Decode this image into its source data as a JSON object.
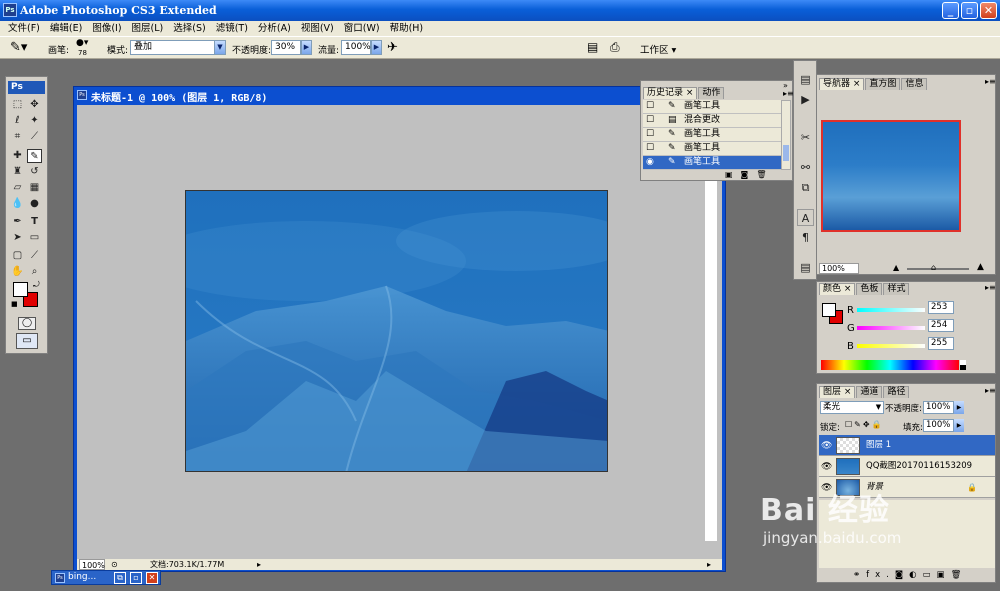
{
  "window": {
    "title": "Adobe Photoshop CS3 Extended"
  },
  "menu": [
    "文件(F)",
    "编辑(E)",
    "图像(I)",
    "图层(L)",
    "选择(S)",
    "滤镜(T)",
    "分析(A)",
    "视图(V)",
    "窗口(W)",
    "帮助(H)"
  ],
  "options": {
    "brush_label": "画笔:",
    "brush_size": "78",
    "mode_label": "模式:",
    "mode_value": "叠加",
    "opacity_label": "不透明度:",
    "opacity_value": "30%",
    "flow_label": "流量:",
    "flow_value": "100%",
    "workspace_label": "工作区"
  },
  "toolbox": {
    "logo": "Ps"
  },
  "document": {
    "title": "未标题-1 @ 100% (图层 1, RGB/8)",
    "zoom": "100%",
    "docinfo": "文档:703.1K/1.77M"
  },
  "history": {
    "tabs": [
      "历史记录",
      "动作"
    ],
    "items": [
      "画笔工具",
      "混合更改",
      "画笔工具",
      "画笔工具",
      "画笔工具"
    ],
    "selected_index": 4
  },
  "navigator": {
    "tabs": [
      "导航器",
      "直方图",
      "信息"
    ],
    "zoom": "100%"
  },
  "color": {
    "tabs": [
      "颜色",
      "色板",
      "样式"
    ],
    "r_label": "R",
    "g_label": "G",
    "b_label": "B",
    "r": "253",
    "g": "254",
    "b": "255",
    "fg": "#fdfeff",
    "bg": "#e00000"
  },
  "layers": {
    "tabs": [
      "图层",
      "通道",
      "路径"
    ],
    "blend_mode": "柔光",
    "opacity_label": "不透明度:",
    "opacity_value": "100%",
    "lock_label": "锁定:",
    "fill_label": "填充:",
    "fill_value": "100%",
    "items": [
      {
        "name": "图层 1",
        "selected": true
      },
      {
        "name": "QQ截图20170116153209",
        "selected": false
      },
      {
        "name": "背景",
        "selected": false
      }
    ],
    "footer": "fx."
  },
  "taskbar": {
    "minimized_doc": "bing..."
  },
  "watermark": {
    "brand": "Bai 经验",
    "url": "jingyan.baidu.com"
  }
}
